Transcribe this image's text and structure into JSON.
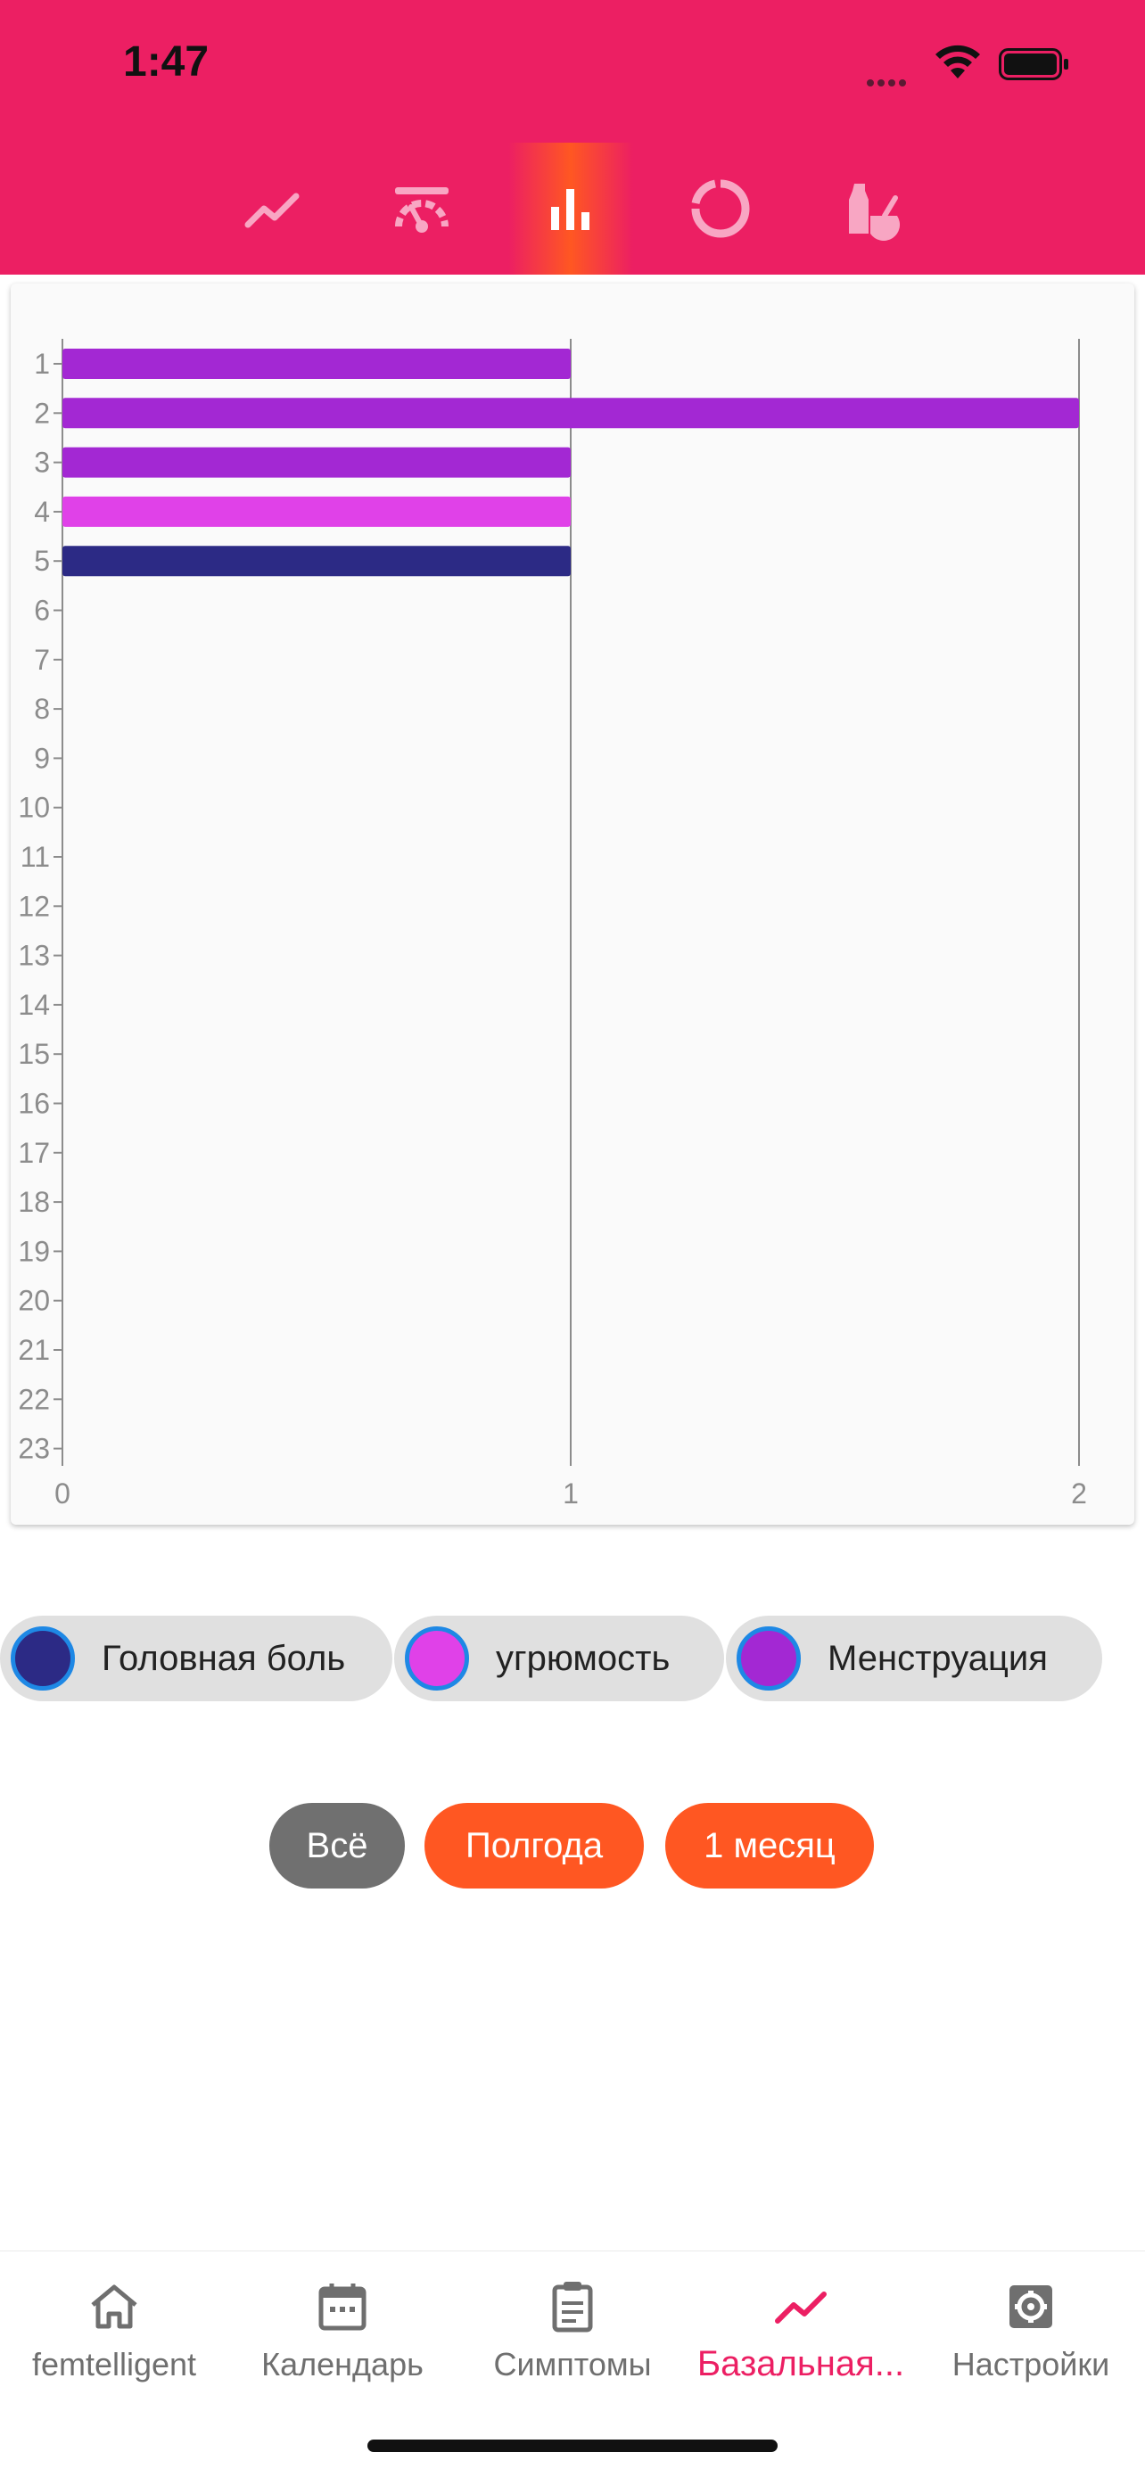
{
  "status_bar": {
    "time": "1:47"
  },
  "header": {
    "chart_tabs": [
      {
        "icon": "line-chart-icon",
        "active": false
      },
      {
        "icon": "gauge-icon",
        "active": false
      },
      {
        "icon": "bar-chart-icon",
        "active": true
      },
      {
        "icon": "donut-chart-icon",
        "active": false
      },
      {
        "icon": "mortar-pestle-icon",
        "active": false
      }
    ],
    "colors": {
      "background": "#EC1F63",
      "active_tab": "#FF5722"
    }
  },
  "chart_data": {
    "type": "bar",
    "orientation": "horizontal",
    "categories": [
      "1",
      "2",
      "3",
      "4",
      "5",
      "6",
      "7",
      "8",
      "9",
      "10",
      "11",
      "12",
      "13",
      "14",
      "15",
      "16",
      "17",
      "18",
      "19",
      "20",
      "21",
      "22",
      "23"
    ],
    "values": [
      1,
      2,
      1,
      1,
      1
    ],
    "bar_colors": [
      "#A328D3",
      "#A328D3",
      "#A328D3",
      "#E041E8",
      "#2C2A85"
    ],
    "x_ticks": [
      "0",
      "1",
      "2"
    ],
    "xlim": [
      0,
      2
    ],
    "grid": "vertical"
  },
  "legend": [
    {
      "label": "Головная боль",
      "color": "#2C2A85"
    },
    {
      "label": "угрюмость",
      "color": "#E041E8"
    },
    {
      "label": "Менструация",
      "color": "#A328D3"
    }
  ],
  "range_buttons": [
    {
      "label": "Всё",
      "color": "#707070"
    },
    {
      "label": "Полгода",
      "color": "#FF5722"
    },
    {
      "label": "1 месяц",
      "color": "#FF5722"
    }
  ],
  "bottom_nav": [
    {
      "label": "femtelligent",
      "icon": "home-icon",
      "active": false
    },
    {
      "label": "Календарь",
      "icon": "calendar-icon",
      "active": false
    },
    {
      "label": "Симптомы",
      "icon": "clipboard-icon",
      "active": false
    },
    {
      "label": "Базальная...",
      "icon": "trend-icon",
      "active": true
    },
    {
      "label": "Настройки",
      "icon": "settings-icon",
      "active": false
    }
  ]
}
